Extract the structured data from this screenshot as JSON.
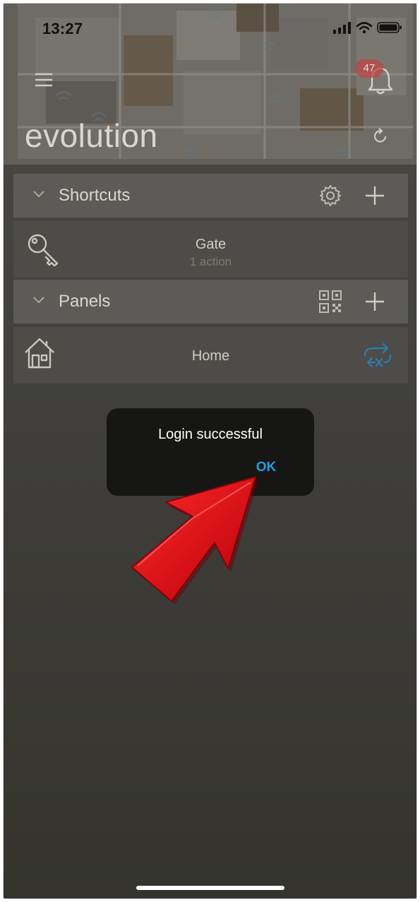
{
  "status_bar": {
    "time": "13:27"
  },
  "header": {
    "title": "evolution",
    "notification_count": "47",
    "menu_icon": "hamburger-icon",
    "bell_icon": "bell-icon",
    "refresh_icon": "refresh-icon"
  },
  "sections": {
    "shortcuts": {
      "label": "Shortcuts",
      "items": [
        {
          "title": "Gate",
          "subtitle": "1 action",
          "icon": "key-icon"
        }
      ]
    },
    "panels": {
      "label": "Panels",
      "items": [
        {
          "title": "Home",
          "icon": "house-icon",
          "status_icon": "sync-off-icon"
        }
      ]
    }
  },
  "dialog": {
    "message": "Login successful",
    "ok_label": "OK"
  },
  "colors": {
    "accent": "#1f9ee6",
    "arrow": "#e3101a",
    "dialog_bg": "#161614",
    "sync_icon": "#2a7fb0"
  }
}
